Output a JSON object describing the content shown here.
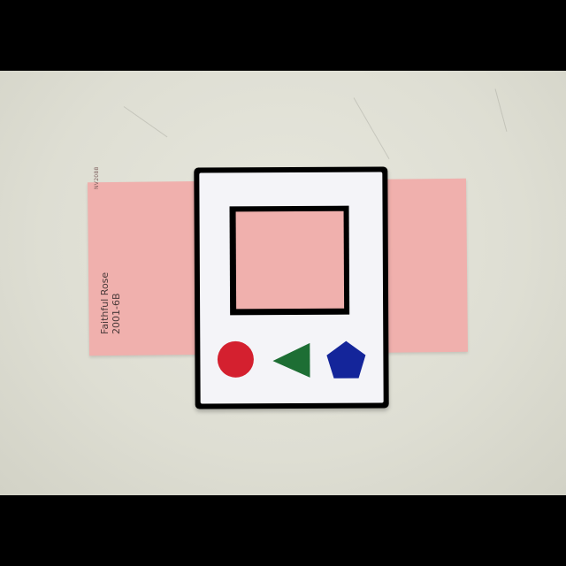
{
  "swatch": {
    "name": "Faithful Rose",
    "code": "2001-6B",
    "small_code": "NV2088",
    "color": "#f0b0ad"
  },
  "frame": {
    "border_color": "#000000",
    "paper_color": "#f4f4f8"
  },
  "shapes": [
    {
      "name": "circle",
      "color": "#d4202f"
    },
    {
      "name": "triangle",
      "color": "#1d6e34"
    },
    {
      "name": "pentagon",
      "color": "#14259a"
    }
  ],
  "background_color": "#e3e3d9"
}
